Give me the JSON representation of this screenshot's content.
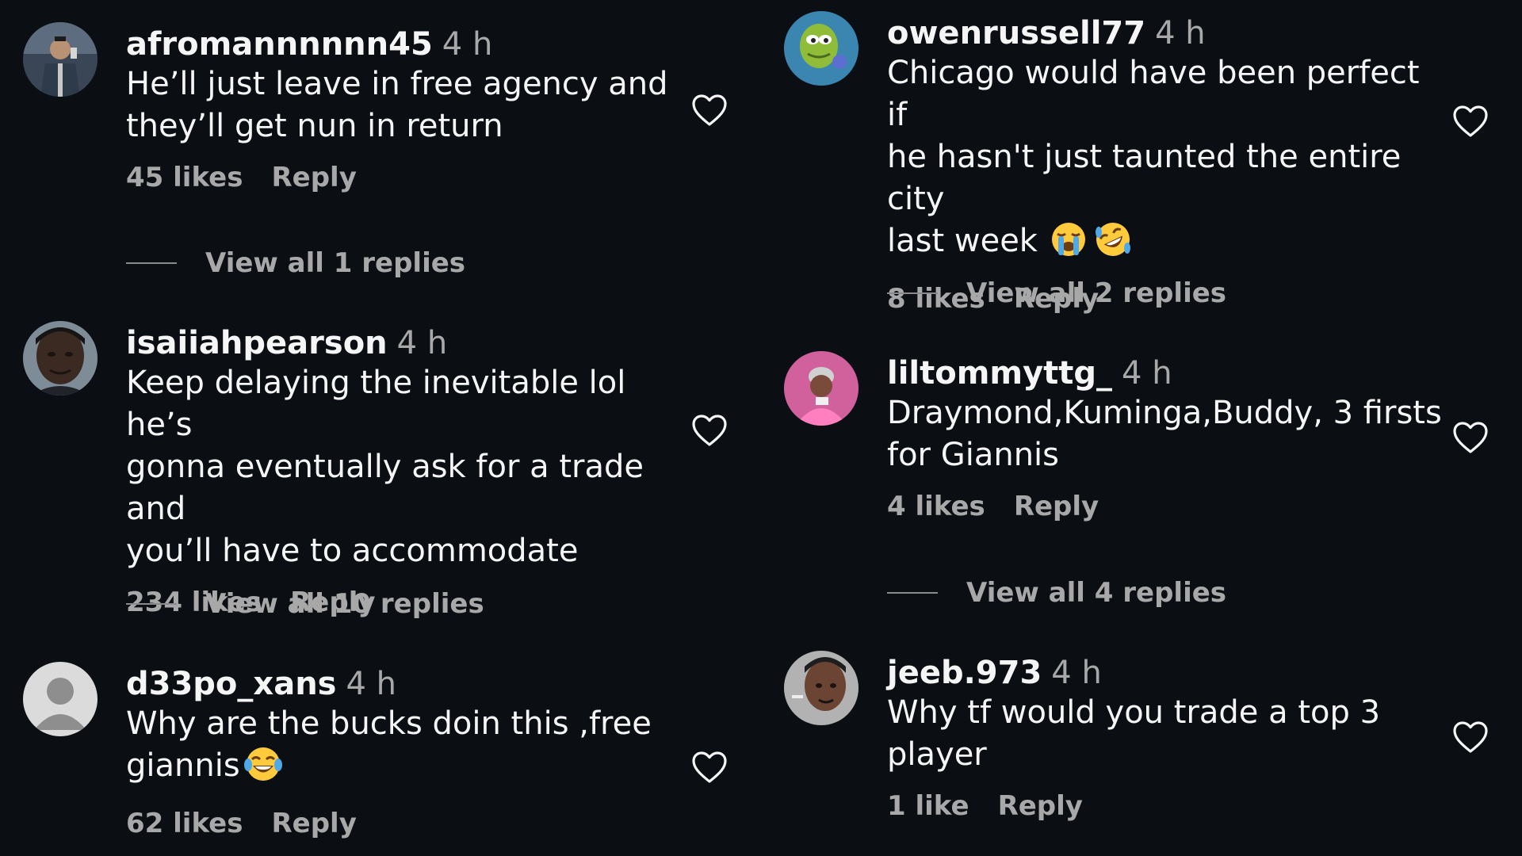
{
  "comments": [
    {
      "username": "afromannnnnn45",
      "time": "4 h",
      "text": "He’ll just leave in free agency and\nthey’ll get nun in return",
      "likes": "45 likes",
      "reply": "Reply",
      "view_replies": "View all 1 replies"
    },
    {
      "username": "isaiiahpearson",
      "time": "4 h",
      "text": "Keep delaying the inevitable lol he’s\ngonna eventually ask for a trade and\nyou’ll have to accommodate",
      "likes": "234 likes",
      "reply": "Reply",
      "view_replies": "View all 10 replies"
    },
    {
      "username": "d33po_xans",
      "time": "4 h",
      "text": "Why are the bucks doin this ,free\ngiannis",
      "likes": "62 likes",
      "reply": "Reply"
    },
    {
      "username": "owenrussell77",
      "time": "4 h",
      "text": "Chicago would have been perfect if\nhe hasn't just taunted the entire city\nlast week",
      "likes": "8 likes",
      "reply": "Reply",
      "view_replies": "View all 2 replies"
    },
    {
      "username": "liltommyttg_",
      "time": "4 h",
      "text": "Draymond,Kuminga,Buddy, 3 firsts\nfor Giannis",
      "likes": "4 likes",
      "reply": "Reply",
      "view_replies": "View all 4 replies"
    },
    {
      "username": "jeeb.973",
      "time": "4 h",
      "text": "Why tf would you trade a top 3\nplayer",
      "likes": "1 like",
      "reply": "Reply"
    }
  ],
  "icons": {
    "like": "heart-outline-icon",
    "emoji_laugh": "laughing-tears-emoji",
    "emoji_cry": "loudly-crying-emoji",
    "emoji_rofl": "rolling-on-floor-laughing-emoji",
    "default_avatar": "default-user-avatar-icon"
  },
  "colors": {
    "background": "#0b0f14",
    "primary_text": "#f5f5f5",
    "secondary_text": "#a8a8a8"
  }
}
